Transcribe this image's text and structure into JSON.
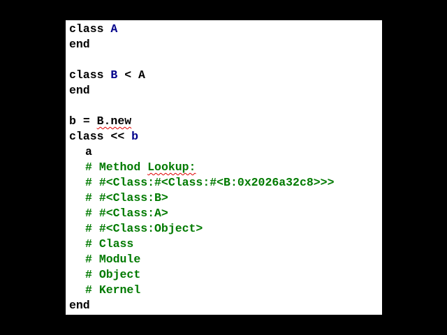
{
  "colors": {
    "background": "#000000",
    "panel": "#ffffff",
    "keyword": "#000000",
    "constant": "#00008b",
    "comment": "#007a00",
    "spellcheck": "#e00000"
  },
  "code": {
    "l1_kw": "class",
    "l1_name": "A",
    "l2_kw": "end",
    "l4_kw": "class",
    "l4_name": "B",
    "l4_op": "<",
    "l4_parent": "A",
    "l5_kw": "end",
    "l7_var": "b",
    "l7_eq": "=",
    "l7_expr": "B.new",
    "l8_kw": "class",
    "l8_op": "<<",
    "l8_target": "b",
    "l9_call": "a",
    "comment_marker": "#",
    "lookup_label": "Method",
    "lookup_word": "Lookup:",
    "ancestors": [
      "#<Class:#<Class:#<B:0x2026a32c8>>>",
      "#<Class:B>",
      "#<Class:A>",
      "#<Class:Object>",
      "Class",
      "Module",
      "Object",
      "Kernel"
    ],
    "last_kw": "end"
  }
}
